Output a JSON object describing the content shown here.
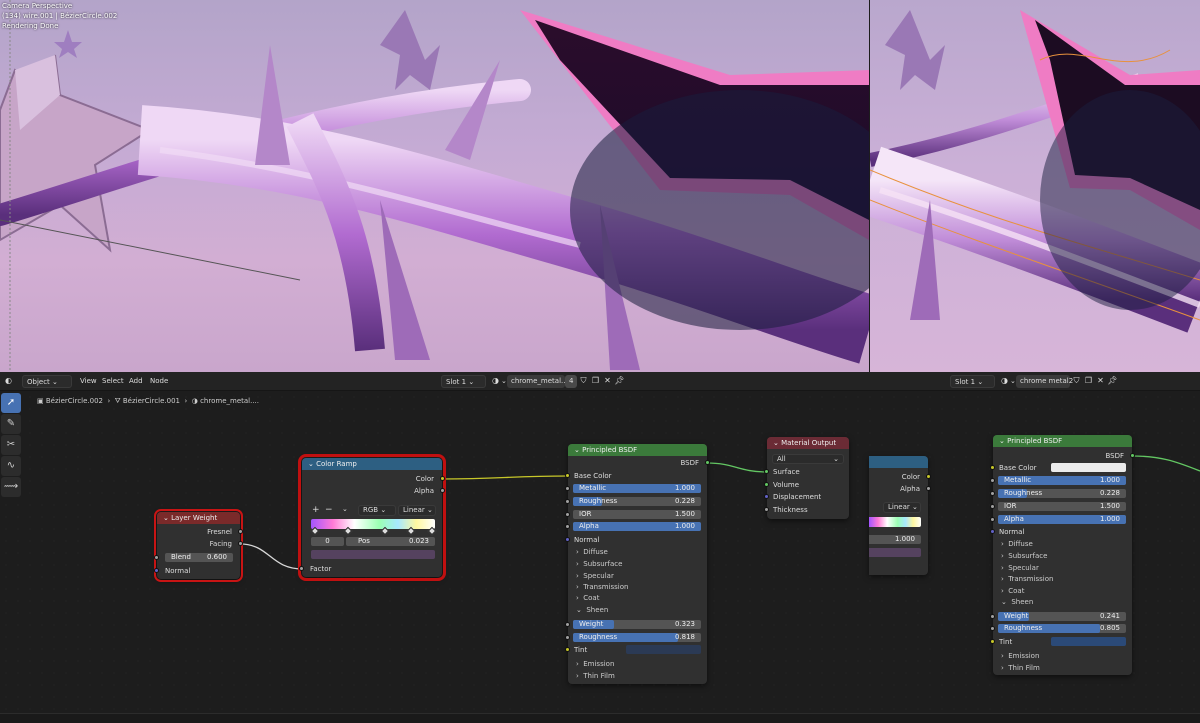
{
  "viewport_overlay": {
    "line1": "Camera Perspective",
    "line2": "(134) wire.001 | BézierCircle.002",
    "line3": "Rendering Done"
  },
  "header": {
    "mode": "Object",
    "menu": [
      "View",
      "Select",
      "Add",
      "Node"
    ],
    "slot_left": "Slot 1",
    "material_left": "chrome_metal....",
    "users_left": "4",
    "slot_right": "Slot 1",
    "material_right": "chrome metal2"
  },
  "breadcrumb": [
    "BézierCircle.002",
    "BézierCircle.001",
    "chrome_metal...."
  ],
  "colors": {
    "accent": "#4772b3",
    "shader_header": "#3b7a3b",
    "input_header": "#7a2a2a",
    "converter_header": "#2d5f82",
    "output_header": "#6b2b35",
    "selection": "#c81414",
    "wire_color": "#c7c729",
    "wire_shader": "#63c763"
  },
  "layer_weight": {
    "title": "Layer Weight",
    "out1": "Fresnel",
    "out2": "Facing",
    "blend_label": "Blend",
    "blend_value": "0.600",
    "blend_fill": 0.6,
    "normal": "Normal"
  },
  "color_ramp": {
    "title": "Color Ramp",
    "out1": "Color",
    "out2": "Alpha",
    "plus": "+",
    "minus": "−",
    "chev": "⌄",
    "mode": "RGB",
    "interp": "Linear",
    "index": "0",
    "pos_label": "Pos",
    "pos_value": "0.023",
    "factor": "Factor"
  },
  "bsdf_left": {
    "title": "Principled BSDF",
    "out": "BSDF",
    "base_color": "Base Color",
    "fields": [
      {
        "label": "Metallic",
        "value": "1.000",
        "fill": 1
      },
      {
        "label": "Roughness",
        "value": "0.228",
        "fill": 0.228
      },
      {
        "label": "IOR",
        "value": "1.500",
        "fill": 0
      },
      {
        "label": "Alpha",
        "value": "1.000",
        "fill": 1
      }
    ],
    "normal": "Normal",
    "sections": [
      "Diffuse",
      "Subsurface",
      "Specular",
      "Transmission",
      "Coat",
      "Sheen"
    ],
    "sheen": [
      {
        "label": "Weight",
        "value": "0.323",
        "fill": 0.323
      },
      {
        "label": "Roughness",
        "value": "0.818",
        "fill": 0.818
      }
    ],
    "tint": "Tint",
    "sections2": [
      "Emission",
      "Thin Film"
    ]
  },
  "material_output": {
    "title": "Material Output",
    "target": "All",
    "inputs": [
      "Surface",
      "Volume",
      "Displacement",
      "Thickness"
    ]
  },
  "partial_ramp": {
    "out1": "Color",
    "out2": "Alpha",
    "interp": "Linear",
    "value": "1.000"
  },
  "bsdf_right": {
    "title": "Principled BSDF",
    "out": "BSDF",
    "base_color": "Base Color",
    "fields": [
      {
        "label": "Metallic",
        "value": "1.000",
        "fill": 1
      },
      {
        "label": "Roughness",
        "value": "0.228",
        "fill": 0.228
      },
      {
        "label": "IOR",
        "value": "1.500",
        "fill": 0
      },
      {
        "label": "Alpha",
        "value": "1.000",
        "fill": 1
      }
    ],
    "normal": "Normal",
    "sections": [
      "Diffuse",
      "Subsurface",
      "Specular",
      "Transmission",
      "Coat",
      "Sheen"
    ],
    "sheen": [
      {
        "label": "Weight",
        "value": "0.241",
        "fill": 0.241
      },
      {
        "label": "Roughness",
        "value": "0.805",
        "fill": 0.805
      }
    ],
    "tint": "Tint",
    "sections2": [
      "Emission",
      "Thin Film"
    ]
  },
  "toolbar": [
    {
      "icon": "select-cursor-icon",
      "glyph": "➚"
    },
    {
      "icon": "annotate-icon",
      "glyph": "✎"
    },
    {
      "icon": "cut-links-icon",
      "glyph": "✂"
    },
    {
      "icon": "lasso-icon",
      "glyph": "∿"
    },
    {
      "icon": "links-icon",
      "glyph": "⟿"
    }
  ]
}
